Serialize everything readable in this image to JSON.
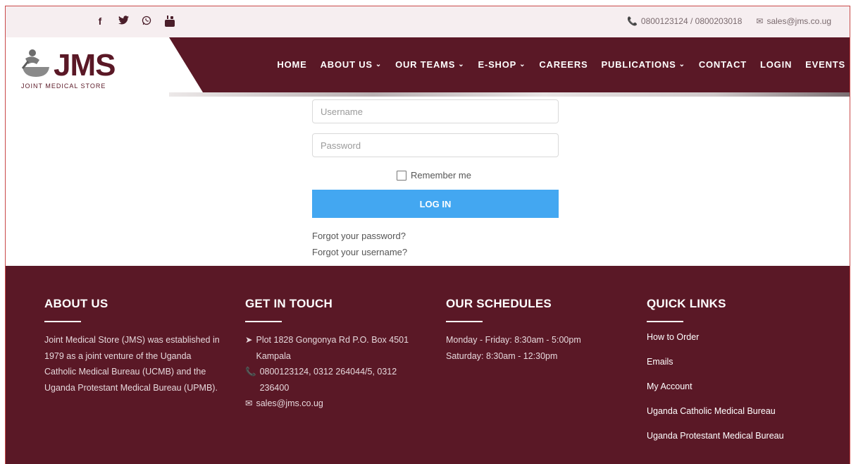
{
  "topbar": {
    "social": [
      {
        "name": "facebook-icon",
        "glyph": "f"
      },
      {
        "name": "twitter-icon",
        "glyph": "🐦"
      },
      {
        "name": "whatsapp-icon",
        "glyph": "✆"
      },
      {
        "name": "youtube-icon",
        "glyph": "▶"
      }
    ],
    "phone": "0800123124 / 0800203018",
    "email": "sales@jms.co.ug"
  },
  "logo": {
    "title": "JMS",
    "subtitle": "JOINT MEDICAL STORE"
  },
  "nav": {
    "home": "HOME",
    "about": "ABOUT US",
    "teams": "OUR TEAMS",
    "eshop": "E-SHOP",
    "careers": "CAREERS",
    "publications": "PUBLICATIONS",
    "contact": "CONTACT",
    "login": "LOGIN",
    "events": "EVENTS"
  },
  "form": {
    "username_placeholder": "Username",
    "password_placeholder": "Password",
    "remember_label": "Remember me",
    "login_button": "LOG IN",
    "forgot_password": "Forgot your password?",
    "forgot_username": "Forgot your username?"
  },
  "footer": {
    "about": {
      "title": "ABOUT US",
      "text": "Joint Medical Store (JMS) was established in 1979 as a joint venture of the Uganda Catholic Medical Bureau (UCMB) and the Uganda Protestant Medical Bureau (UPMB)."
    },
    "touch": {
      "title": "GET IN TOUCH",
      "address": "Plot 1828 Gongonya Rd P.O. Box 4501 Kampala",
      "phones": "0800123124, 0312 264044/5, 0312 236400",
      "email": "sales@jms.co.ug"
    },
    "schedules": {
      "title": "OUR SCHEDULES",
      "weekdays": "Monday - Friday: 8:30am - 5:00pm",
      "saturday": "Saturday: 8:30am - 12:30pm"
    },
    "quick": {
      "title": "QUICK LINKS",
      "links": [
        "How to Order",
        "Emails",
        "My Account",
        "Uganda Catholic Medical Bureau",
        "Uganda Protestant Medical Bureau"
      ]
    }
  },
  "colors": {
    "brand": "#5a1826",
    "button": "#43a7f1",
    "topbar": "#f6eef0"
  }
}
